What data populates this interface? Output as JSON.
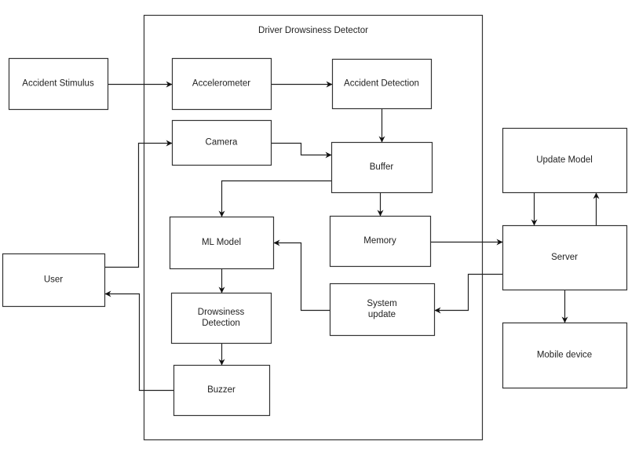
{
  "diagram": {
    "title": "Driver Drowsiness Detector",
    "container": {
      "id": "driver-drowsiness-detector",
      "label": "Driver Drowsiness Detector"
    },
    "nodes": [
      {
        "id": "accident-stimulus",
        "lines": [
          "Accident Stimulus"
        ]
      },
      {
        "id": "accelerometer",
        "lines": [
          "Accelerometer"
        ]
      },
      {
        "id": "accident-detection",
        "lines": [
          "Accident Detection"
        ]
      },
      {
        "id": "camera",
        "lines": [
          "Camera"
        ]
      },
      {
        "id": "buffer",
        "lines": [
          "Buffer"
        ]
      },
      {
        "id": "ml-model",
        "lines": [
          "ML Model"
        ]
      },
      {
        "id": "memory",
        "lines": [
          "Memory"
        ]
      },
      {
        "id": "drowsiness-detection",
        "lines": [
          "Drowsiness",
          "Detection"
        ]
      },
      {
        "id": "system-update",
        "lines": [
          "System",
          "update"
        ]
      },
      {
        "id": "buzzer",
        "lines": [
          "Buzzer"
        ]
      },
      {
        "id": "user",
        "lines": [
          "User"
        ]
      },
      {
        "id": "update-model",
        "lines": [
          "Update Model"
        ]
      },
      {
        "id": "server",
        "lines": [
          "Server"
        ]
      },
      {
        "id": "mobile-device",
        "lines": [
          "Mobile device"
        ]
      }
    ],
    "edges": [
      {
        "from": "accident-stimulus",
        "to": "accelerometer"
      },
      {
        "from": "accelerometer",
        "to": "accident-detection"
      },
      {
        "from": "accident-detection",
        "to": "buffer"
      },
      {
        "from": "camera",
        "to": "buffer"
      },
      {
        "from": "user",
        "to": "camera"
      },
      {
        "from": "buffer",
        "to": "ml-model"
      },
      {
        "from": "buffer",
        "to": "memory"
      },
      {
        "from": "memory",
        "to": "server"
      },
      {
        "from": "server",
        "to": "system-update"
      },
      {
        "from": "system-update",
        "to": "ml-model"
      },
      {
        "from": "ml-model",
        "to": "drowsiness-detection"
      },
      {
        "from": "drowsiness-detection",
        "to": "buzzer"
      },
      {
        "from": "buzzer",
        "to": "user"
      },
      {
        "from": "update-model",
        "to": "server"
      },
      {
        "from": "server",
        "to": "update-model"
      },
      {
        "from": "server",
        "to": "mobile-device"
      }
    ]
  }
}
